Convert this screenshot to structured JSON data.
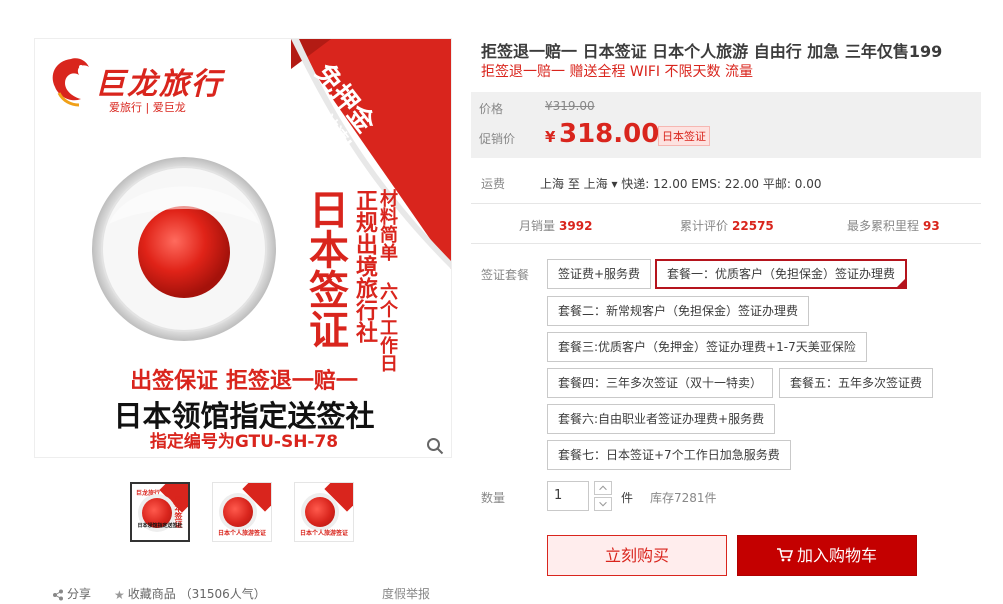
{
  "gallery": {
    "logo_name": "巨龙旅行",
    "logo_tagline": "爱旅行 | 爱巨龙",
    "corner_big": "免押金",
    "corner_small": "专业!神速!",
    "vertical_big": "日本签证",
    "vertical_mid": "正规出境旅行社",
    "vertical_small": "材料简单 六个工作日",
    "banner_line1": "出签保证 拒签退一赔一",
    "banner_line2": "日本领馆指定送签社",
    "banner_line3": "指定编号为GTU-SH-78",
    "thumbnails": [
      {
        "logo": "巨龙旅行",
        "caption_top": "日本领馆指定送签社",
        "caption": "",
        "side": "日本签证"
      },
      {
        "logo": "",
        "caption_top": "",
        "caption": "日本个人旅游签证",
        "side": ""
      },
      {
        "logo": "",
        "caption_top": "",
        "caption": "日本个人旅游签证",
        "side": ""
      }
    ],
    "share_label": "分享",
    "favorite_label": "收藏商品 （31506人气）",
    "report_label": "度假举报"
  },
  "product": {
    "title": "拒签退一赔一 日本签证 日本个人旅游 自由行 加急 三年仅售199",
    "subtitle": "拒签退一赔一 赠送全程 WIFI 不限天数 流量",
    "price_label": "价格",
    "original_price": "¥319.00",
    "promo_label": "促销价",
    "currency": "¥",
    "promo_price": "318.00",
    "promo_tag": "日本签证"
  },
  "shipping": {
    "label": "运费",
    "text": "上海 至 上海 ▾ 快递: 12.00 EMS: 22.00 平邮: 0.00"
  },
  "stats": {
    "monthly_sales_label": "月销量",
    "monthly_sales": "3992",
    "reviews_label": "累计评价",
    "reviews": "22575",
    "mileage_label": "最多累积里程",
    "mileage": "93"
  },
  "packages": {
    "label": "签证套餐",
    "options": [
      "签证费+服务费",
      "套餐一：优质客户（免担保金）签证办理费",
      "套餐二：新常规客户（免担保金）签证办理费",
      "套餐三:优质客户（免押金）签证办理费+1-7天美亚保险",
      "套餐四：三年多次签证（双十一特卖）",
      "套餐五：五年多次签证费",
      "套餐六:自由职业者签证办理费+服务费",
      "套餐七：日本签证+7个工作日加急服务费"
    ],
    "selected_index": 1
  },
  "quantity": {
    "label": "数量",
    "value": "1",
    "unit": "件",
    "stock": "库存7281件"
  },
  "actions": {
    "buy_now": "立刻购买",
    "add_to_cart": "加入购物车"
  },
  "colors": {
    "accent": "#d9251d",
    "cart_button": "#c40000",
    "price_bg": "#f0f0f0"
  }
}
